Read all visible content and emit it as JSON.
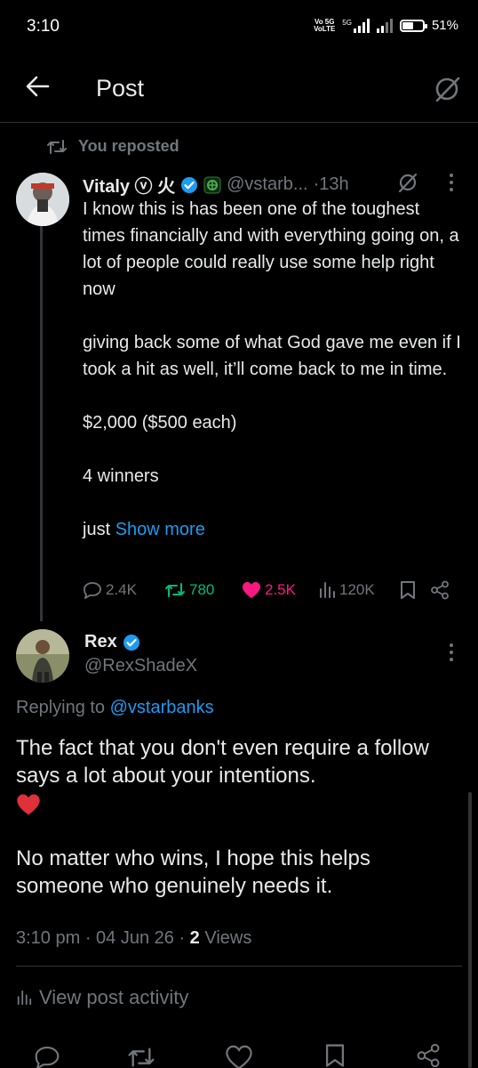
{
  "status_bar": {
    "time": "3:10",
    "network_top": "Vo 5G",
    "network_bottom": "VoLTE",
    "net_type": "5G",
    "battery": "51%"
  },
  "header": {
    "title": "Post"
  },
  "repost": {
    "label": "You reposted"
  },
  "original_post": {
    "author_name": "Vitaly ⓥ 火",
    "handle": "@vstarb...",
    "time": "·13h",
    "paragraphs": [
      "I know this is has been one of the toughest times financially and with everything going on, a lot of people could really use some help right now",
      "giving back some of what God gave me even if I took a hit as well, it’ll come back to me in time.",
      "$2,000 ($500 each)",
      "4 winners"
    ],
    "truncated_prefix": "just ",
    "show_more": "Show more",
    "stats": {
      "replies": "2.4K",
      "reposts": "780",
      "likes": "2.5K",
      "views": "120K"
    }
  },
  "reply_post": {
    "author_name": "Rex",
    "handle": "@RexShadeX",
    "replying_prefix": "Replying to ",
    "replying_handle": "@vstarbanks",
    "text_1": "The fact that you don't even require a follow says a lot about your intentions.",
    "emoji": "❤️",
    "text_2": "No matter who wins, I hope this helps someone who genuinely needs it.",
    "time": "3:10 pm · 04 Jun 26 · ",
    "views_count": "2",
    "views_label": " Views"
  },
  "activity": {
    "label": "View post activity"
  },
  "colors": {
    "accent": "#1d9bf0",
    "like": "#f91880",
    "repost": "#00ba7c",
    "muted": "#71767b",
    "background": "#000000"
  }
}
